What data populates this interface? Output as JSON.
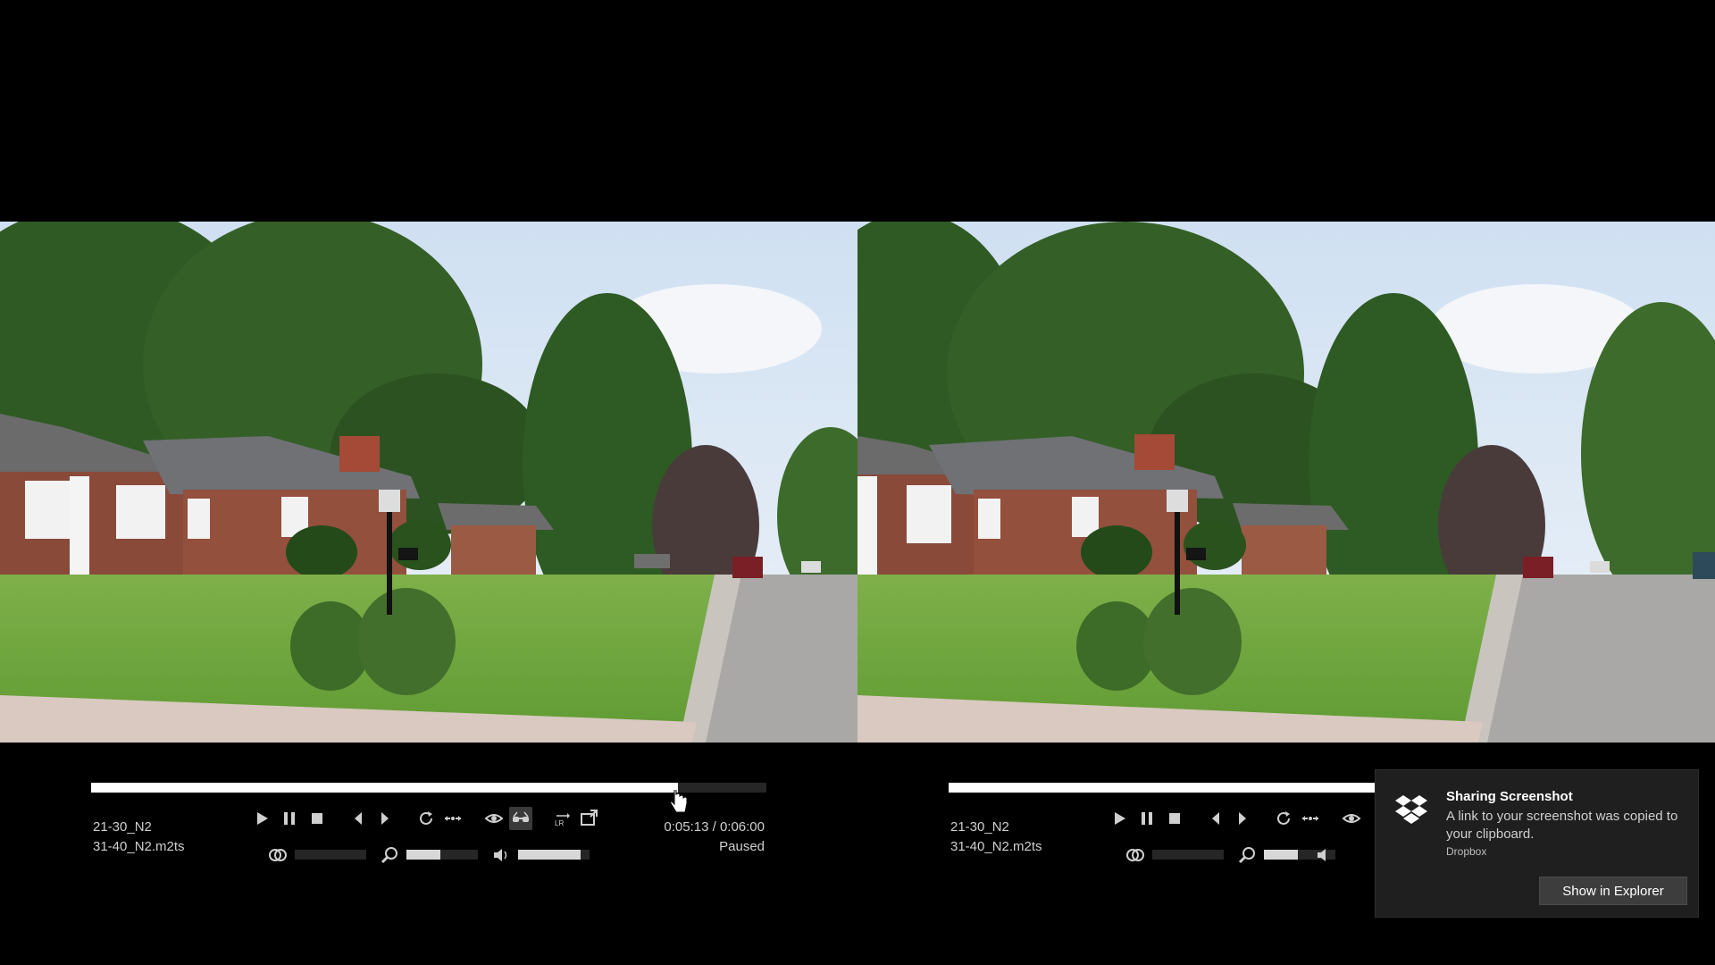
{
  "left_player": {
    "file_line1": "21-30_N2",
    "file_line2": "31-40_N2.m2ts",
    "time": "0:05:13 / 0:06:00",
    "status": "Paused",
    "seek_progress": 0.869,
    "parallax_level": 0.0,
    "zoom_level": 0.48,
    "volume_level": 0.88
  },
  "right_player": {
    "file_line1": "21-30_N2",
    "file_line2": "31-40_N2.m2ts",
    "seek_progress": 0.869,
    "parallax_level": 0.0,
    "zoom_level": 0.48
  },
  "toast": {
    "title": "Sharing Screenshot",
    "body": "A link to your screenshot was copied to your clipboard.",
    "source": "Dropbox",
    "button": "Show in Explorer"
  },
  "icons": {
    "play": "play-icon",
    "pause": "pause-icon",
    "stop": "stop-icon",
    "previous": "previous-icon",
    "next": "next-icon",
    "loop": "loop-icon",
    "swap": "swap-icon",
    "view": "eye-icon",
    "stereo": "stereo-glasses-icon",
    "swap_lr": "swap-lr-icon",
    "fullscreen": "fullscreen-icon",
    "parallax": "parallax-icon",
    "zoom": "zoom-icon",
    "volume": "volume-icon",
    "dropbox": "dropbox-icon"
  },
  "colors": {
    "background": "#000000",
    "panel_text": "#cfcfcf",
    "toast_bg": "#1f1f1f",
    "button_bg": "#3d3d3d"
  }
}
